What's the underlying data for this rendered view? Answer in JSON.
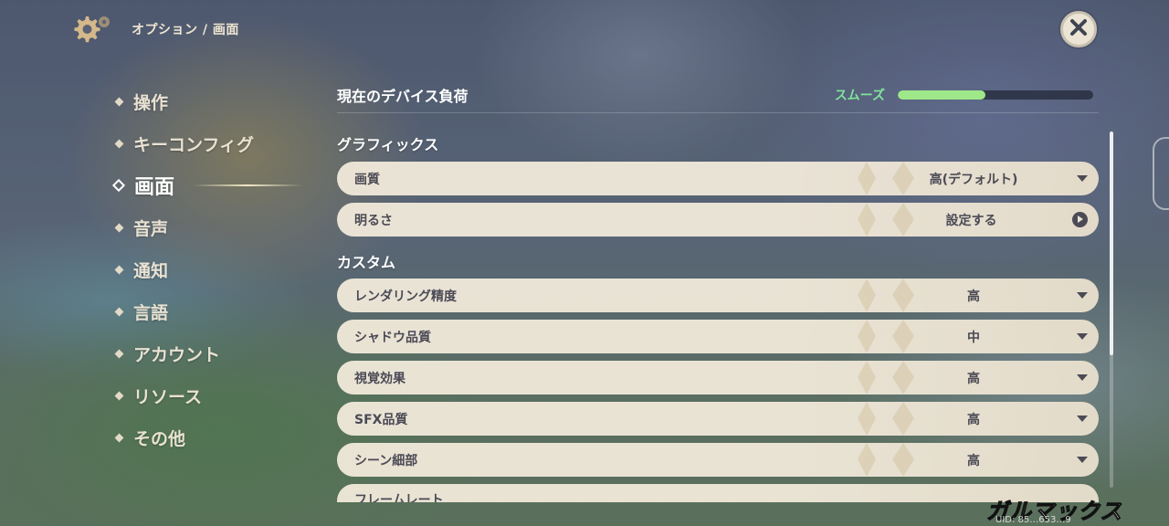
{
  "header": {
    "breadcrumb": "オプション / 画面",
    "gear_icon": "gear-icon",
    "close_icon": "close-icon"
  },
  "nav": {
    "items": [
      {
        "label": "操作",
        "active": false
      },
      {
        "label": "キーコンフィグ",
        "active": false
      },
      {
        "label": "画面",
        "active": true
      },
      {
        "label": "音声",
        "active": false
      },
      {
        "label": "通知",
        "active": false
      },
      {
        "label": "言語",
        "active": false
      },
      {
        "label": "アカウント",
        "active": false
      },
      {
        "label": "リソース",
        "active": false
      },
      {
        "label": "その他",
        "active": false
      }
    ]
  },
  "device_load": {
    "title": "現在のデバイス負荷",
    "status": "スムーズ",
    "level": 0.45,
    "status_color": "#7fe39b"
  },
  "graphics": {
    "title": "グラフィックス",
    "rows": [
      {
        "label": "画質",
        "value": "高(デフォルト)",
        "control": "dropdown"
      },
      {
        "label": "明るさ",
        "value": "設定する",
        "control": "arrow"
      }
    ]
  },
  "custom": {
    "title": "カスタム",
    "rows": [
      {
        "label": "レンダリング精度",
        "value": "高",
        "control": "dropdown"
      },
      {
        "label": "シャドウ品質",
        "value": "中",
        "control": "dropdown"
      },
      {
        "label": "視覚効果",
        "value": "高",
        "control": "dropdown"
      },
      {
        "label": "SFX品質",
        "value": "高",
        "control": "dropdown"
      },
      {
        "label": "シーン細部",
        "value": "高",
        "control": "dropdown"
      },
      {
        "label": "フレームレート",
        "value": "",
        "control": "dropdown"
      }
    ]
  },
  "watermark": {
    "uid": "UID: 85…653…9",
    "logo": "ガルマックス"
  },
  "colors": {
    "accent": "#7fe39b",
    "row_bg": "#ece5d5",
    "row_text": "#4b4a55"
  }
}
